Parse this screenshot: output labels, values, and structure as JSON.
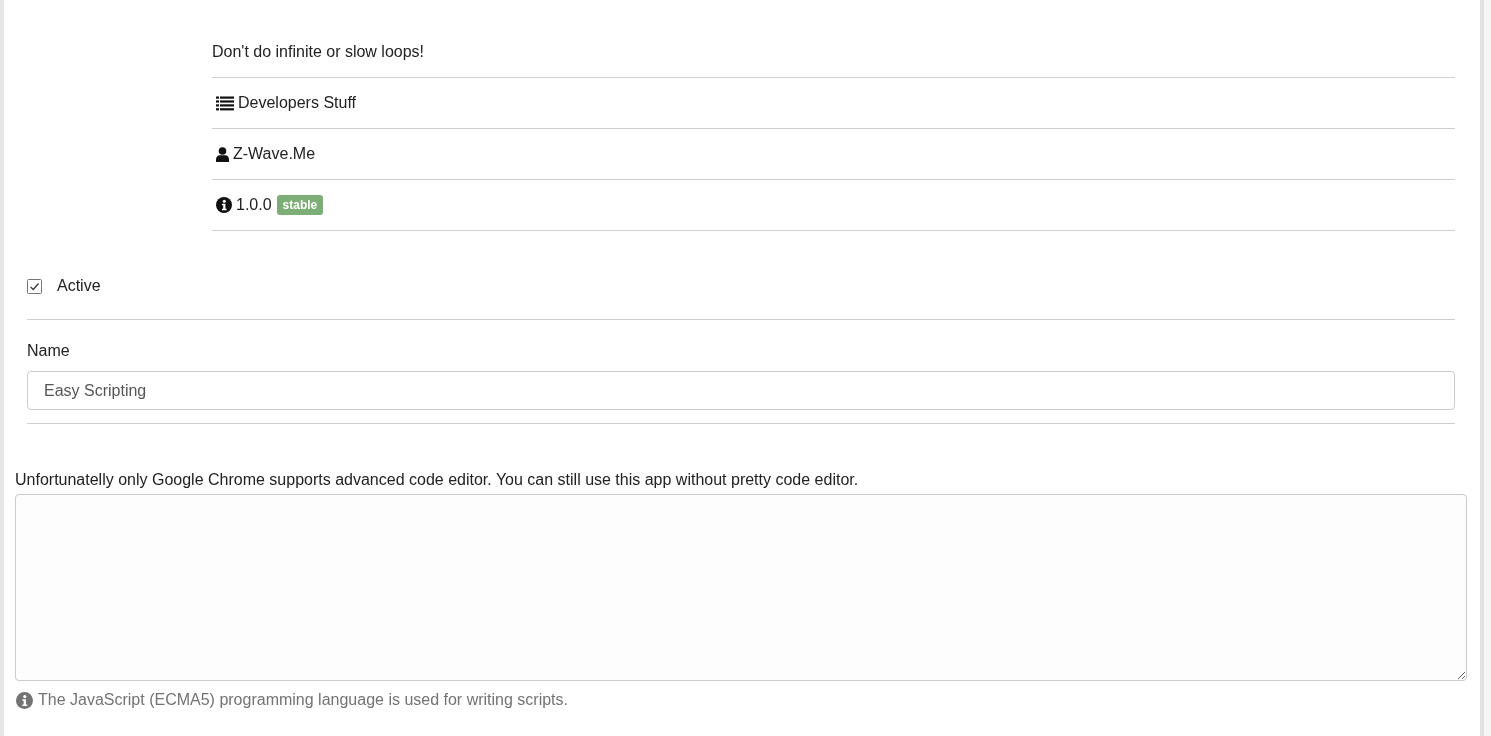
{
  "description": {
    "text": "Don't do infinite or slow loops!"
  },
  "meta": [
    {
      "kind": "category",
      "text": "Developers Stuff"
    },
    {
      "kind": "author",
      "text": "Z-Wave.Me"
    },
    {
      "kind": "version",
      "text": "1.0.0",
      "badge": "stable"
    }
  ],
  "active": {
    "label": "Active",
    "checked": true
  },
  "name_field": {
    "label": "Name",
    "value": "Easy Scripting"
  },
  "editor": {
    "notice": "Unfortunatelly only Google Chrome supports advanced code editor. You can still use this app without pretty code editor.",
    "help": "The JavaScript (ECMA5) programming language is used for writing scripts."
  }
}
